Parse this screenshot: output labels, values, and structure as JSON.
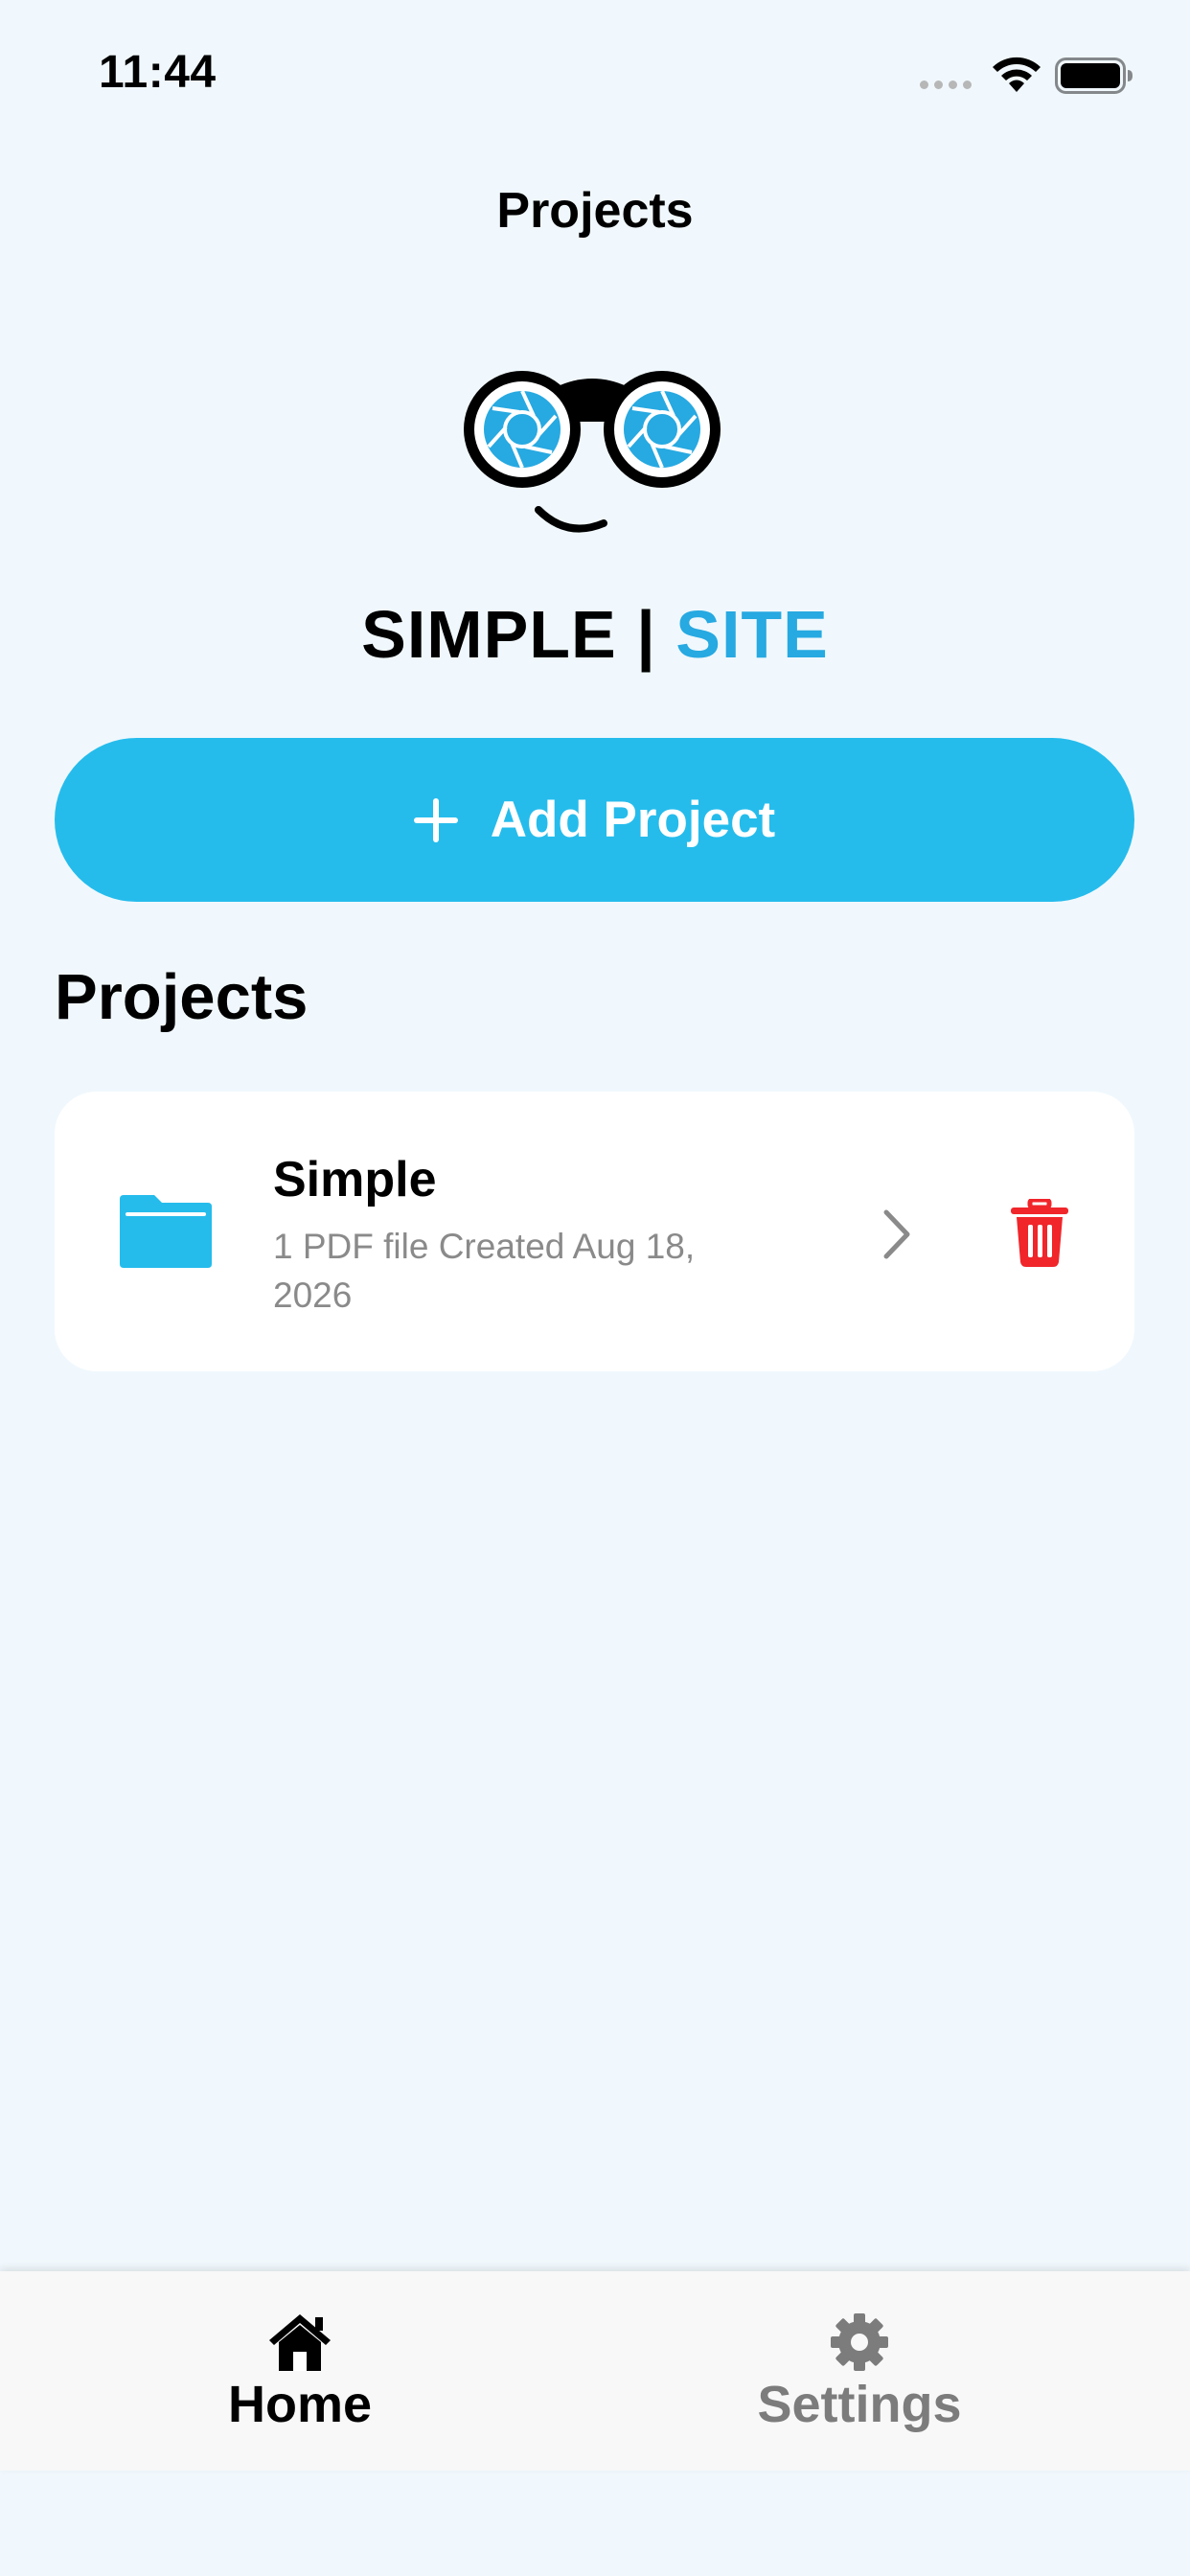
{
  "status_bar": {
    "time": "11:44"
  },
  "nav": {
    "title": "Projects"
  },
  "logo": {
    "brand_primary": "SIMPLE",
    "separator": "|",
    "brand_accent": "SITE",
    "accent_color": "#27A9E1"
  },
  "add_button": {
    "label": "Add Project",
    "icon": "plus-icon",
    "color": "#25BCEC"
  },
  "section": {
    "title": "Projects"
  },
  "projects": [
    {
      "name": "Simple",
      "meta": "1 PDF file  Created Aug 18, 2026",
      "icon": "folder-icon",
      "actions": [
        "chevron-right-icon",
        "trash-icon"
      ]
    }
  ],
  "tab_bar": {
    "tabs": [
      {
        "label": "Home",
        "icon": "house-icon",
        "selected": true
      },
      {
        "label": "Settings",
        "icon": "gear-icon",
        "selected": false
      }
    ]
  },
  "colors": {
    "background": "#F0F8FD",
    "delete": "#F0262B",
    "folder": "#25BCEC"
  }
}
